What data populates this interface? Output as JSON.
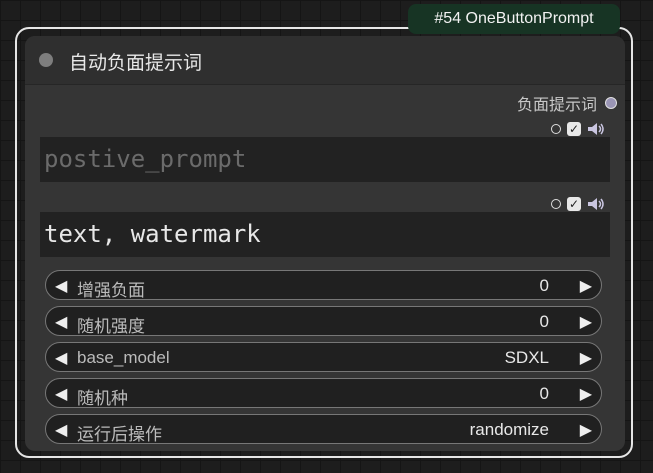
{
  "badge": "#54 OneButtonPrompt",
  "node": {
    "title": "自动负面提示词",
    "output_label": "负面提示词",
    "prompt_input": {
      "placeholder": "postive_prompt",
      "value": ""
    },
    "negative_input": {
      "value": "text, watermark"
    },
    "widgets": [
      {
        "label": "增强负面",
        "value": "0"
      },
      {
        "label": "随机强度",
        "value": "0"
      },
      {
        "label": "base_model",
        "value": "SDXL"
      },
      {
        "label": "随机种",
        "value": "0"
      },
      {
        "label": "运行后操作",
        "value": "randomize"
      }
    ],
    "check_mark": "✓",
    "arrow_left": "◀",
    "arrow_right": "▶"
  },
  "icons": [
    "collapse-dot-icon",
    "output-slot-icon",
    "toggle-circle-icon",
    "checkbox-icon",
    "speaker-icon",
    "arrow-left-icon",
    "arrow-right-icon"
  ],
  "colors": {
    "badge_bg": "#173424",
    "node_bg": "#353535",
    "output_slot": "#9a95b5"
  }
}
